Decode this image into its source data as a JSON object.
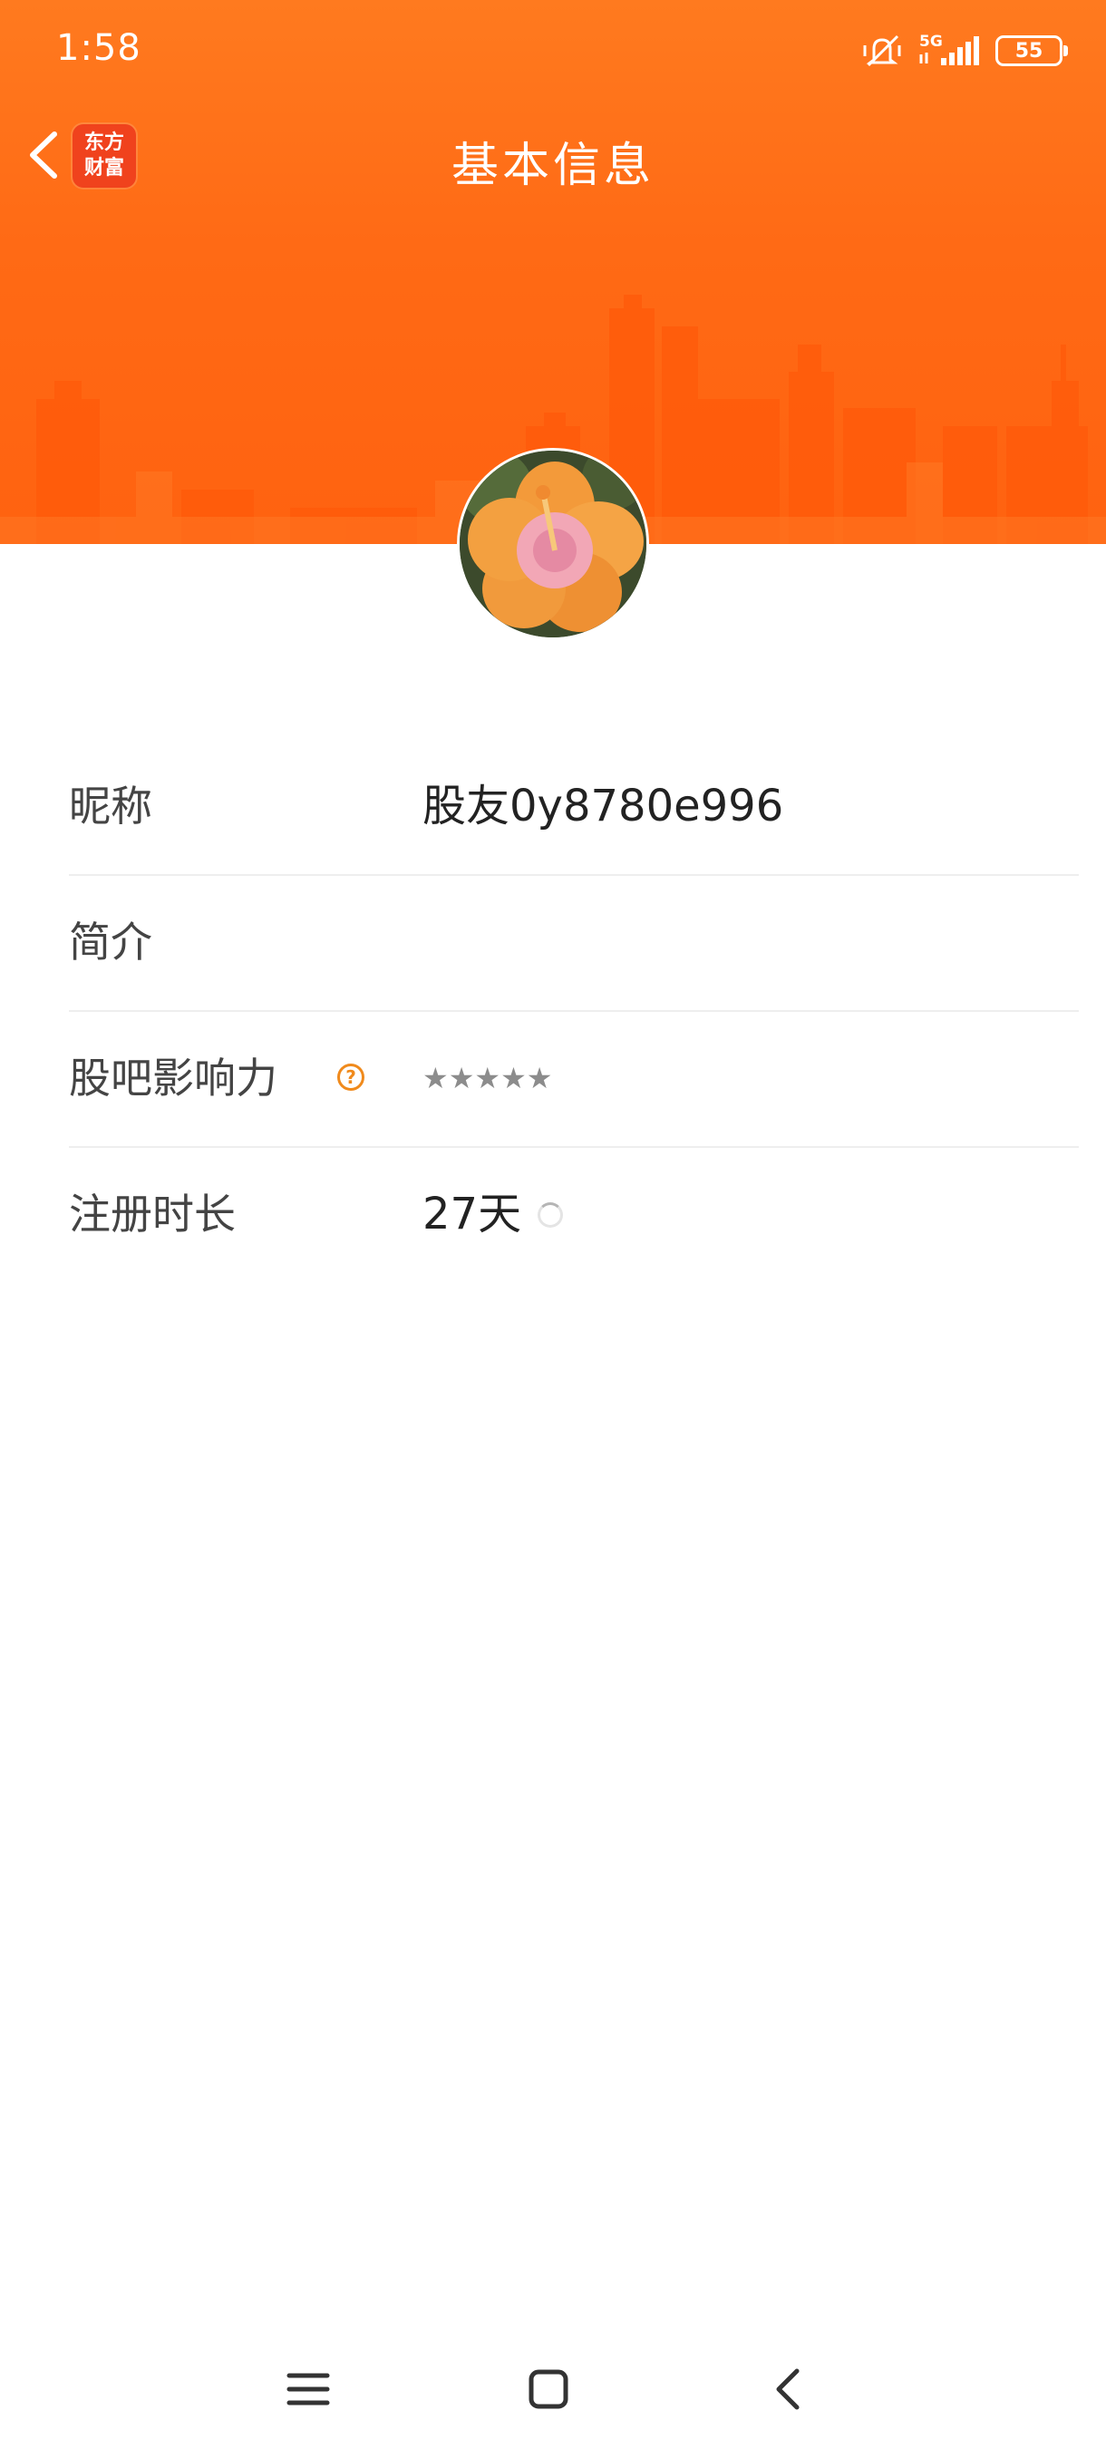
{
  "status_bar": {
    "time": "1:58",
    "network": "5G",
    "battery": "55",
    "icons": [
      "vibrate-off-icon",
      "signal-5g-icon",
      "battery-icon"
    ]
  },
  "header": {
    "title": "基本信息",
    "logo_line1": "东方",
    "logo_line2": "财富",
    "background_color": "#ff6a15",
    "logo_color": "#f0421d"
  },
  "profile": {
    "avatar": "hibiscus-flower-photo",
    "fields": [
      {
        "label": "昵称",
        "value": "股友0y8780e996"
      },
      {
        "label": "简介",
        "value": ""
      },
      {
        "label": "股吧影响力",
        "value": "★★★★★",
        "help_icon": "question-circle-icon"
      },
      {
        "label": "注册时长",
        "value": "27天",
        "status_icon": "loading-spinner-icon"
      }
    ]
  },
  "system_nav": {
    "buttons": [
      "menu-icon",
      "home-icon",
      "back-icon"
    ]
  }
}
